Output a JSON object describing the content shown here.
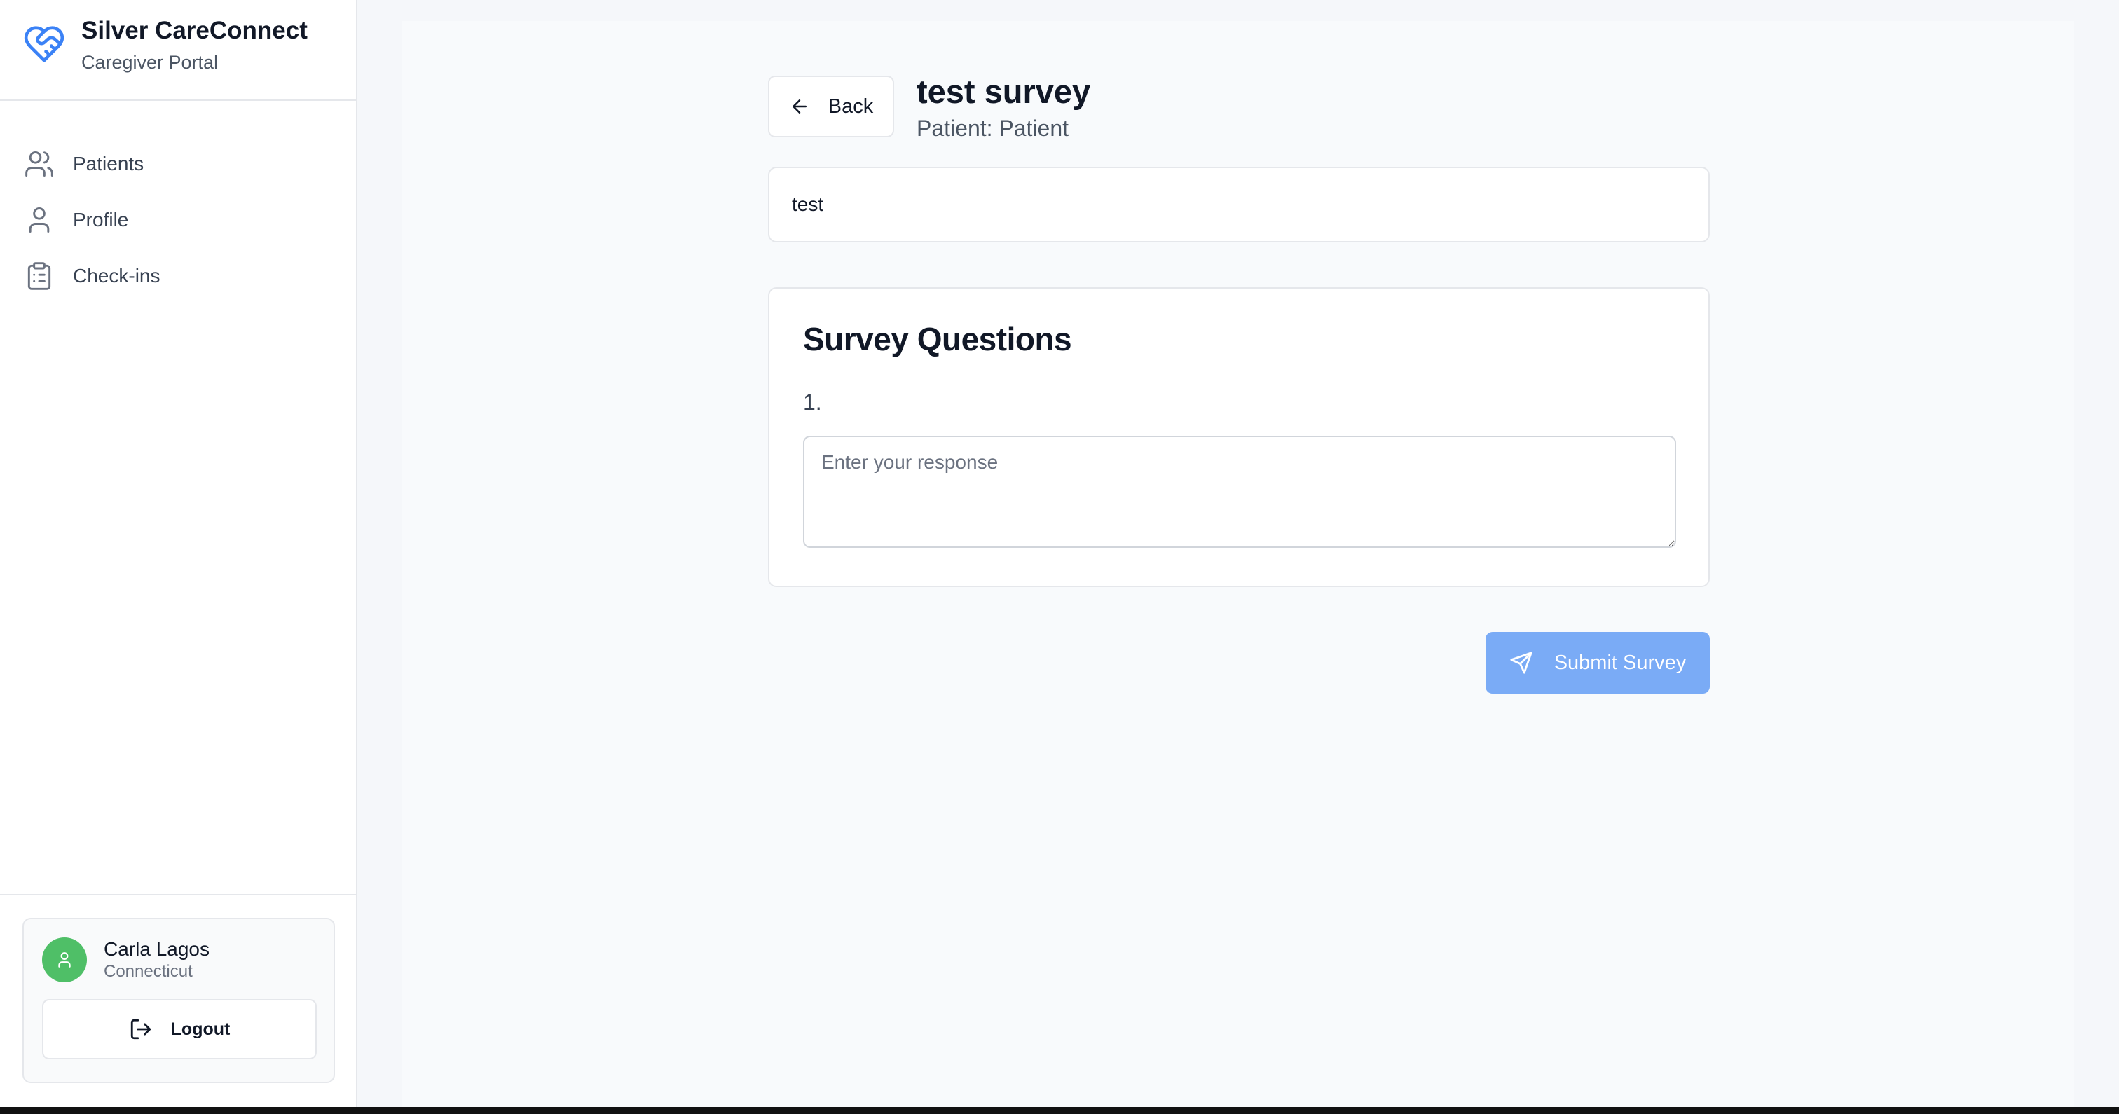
{
  "brand": {
    "title": "Silver CareConnect",
    "subtitle": "Caregiver Portal",
    "logo_icon": "heart-handshake-icon",
    "accent_color": "#3b82f6"
  },
  "nav": {
    "items": [
      {
        "label": "Patients",
        "icon": "users-icon"
      },
      {
        "label": "Profile",
        "icon": "user-icon"
      },
      {
        "label": "Check-ins",
        "icon": "clipboard-list-icon"
      }
    ]
  },
  "user": {
    "name": "Carla Lagos",
    "state": "Connecticut",
    "avatar_color": "#4fbf67",
    "logout_label": "Logout"
  },
  "header": {
    "back_label": "Back",
    "title": "test survey",
    "subtitle": "Patient: Patient"
  },
  "survey": {
    "description": "test",
    "section_title": "Survey Questions",
    "questions": [
      {
        "number": "1.",
        "text": "",
        "placeholder": "Enter your response",
        "value": ""
      }
    ],
    "submit_label": "Submit Survey",
    "submit_color": "#7aabf6"
  }
}
